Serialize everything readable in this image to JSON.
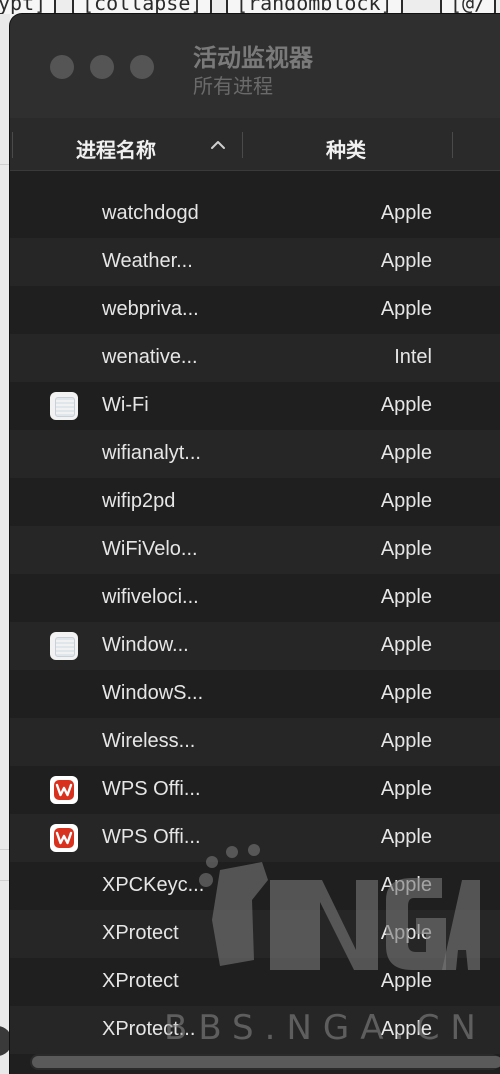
{
  "background_tabs": [
    "ypt]",
    "[collapse]",
    "[randomblock]",
    "[@/"
  ],
  "window": {
    "title": "活动监视器",
    "subtitle": "所有进程"
  },
  "columns": {
    "name": "进程名称",
    "kind": "种类"
  },
  "rows": [
    {
      "name": "watchdogd",
      "kind": "Apple",
      "icon": ""
    },
    {
      "name": "Weather...",
      "kind": "Apple",
      "icon": ""
    },
    {
      "name": "webpriva...",
      "kind": "Apple",
      "icon": ""
    },
    {
      "name": "wenative...",
      "kind": "Intel",
      "icon": ""
    },
    {
      "name": "Wi-Fi",
      "kind": "Apple",
      "icon": "wifi-app-icon"
    },
    {
      "name": "wifianalyt...",
      "kind": "Apple",
      "icon": ""
    },
    {
      "name": "wifip2pd",
      "kind": "Apple",
      "icon": ""
    },
    {
      "name": "WiFiVelo...",
      "kind": "Apple",
      "icon": ""
    },
    {
      "name": "wifiveloci...",
      "kind": "Apple",
      "icon": ""
    },
    {
      "name": "Window...",
      "kind": "Apple",
      "icon": "wifi-app-icon"
    },
    {
      "name": "WindowS...",
      "kind": "Apple",
      "icon": ""
    },
    {
      "name": "Wireless...",
      "kind": "Apple",
      "icon": ""
    },
    {
      "name": "WPS Offi...",
      "kind": "Apple",
      "icon": "wps-icon"
    },
    {
      "name": "WPS Offi...",
      "kind": "Apple",
      "icon": "wps-icon"
    },
    {
      "name": "XPCKeyc...",
      "kind": "Apple",
      "icon": ""
    },
    {
      "name": "XProtect",
      "kind": "Apple",
      "icon": ""
    },
    {
      "name": "XProtect",
      "kind": "Apple",
      "icon": ""
    },
    {
      "name": "XProtect...",
      "kind": "Apple",
      "icon": ""
    }
  ],
  "watermark": {
    "logo": "NGA",
    "site": "BBS.NGA.CN"
  },
  "colors": {
    "window_bg": "#1f1f1f",
    "row_alt": "#262626",
    "text": "#e6e6e6",
    "wps_red": "#d8321f"
  }
}
